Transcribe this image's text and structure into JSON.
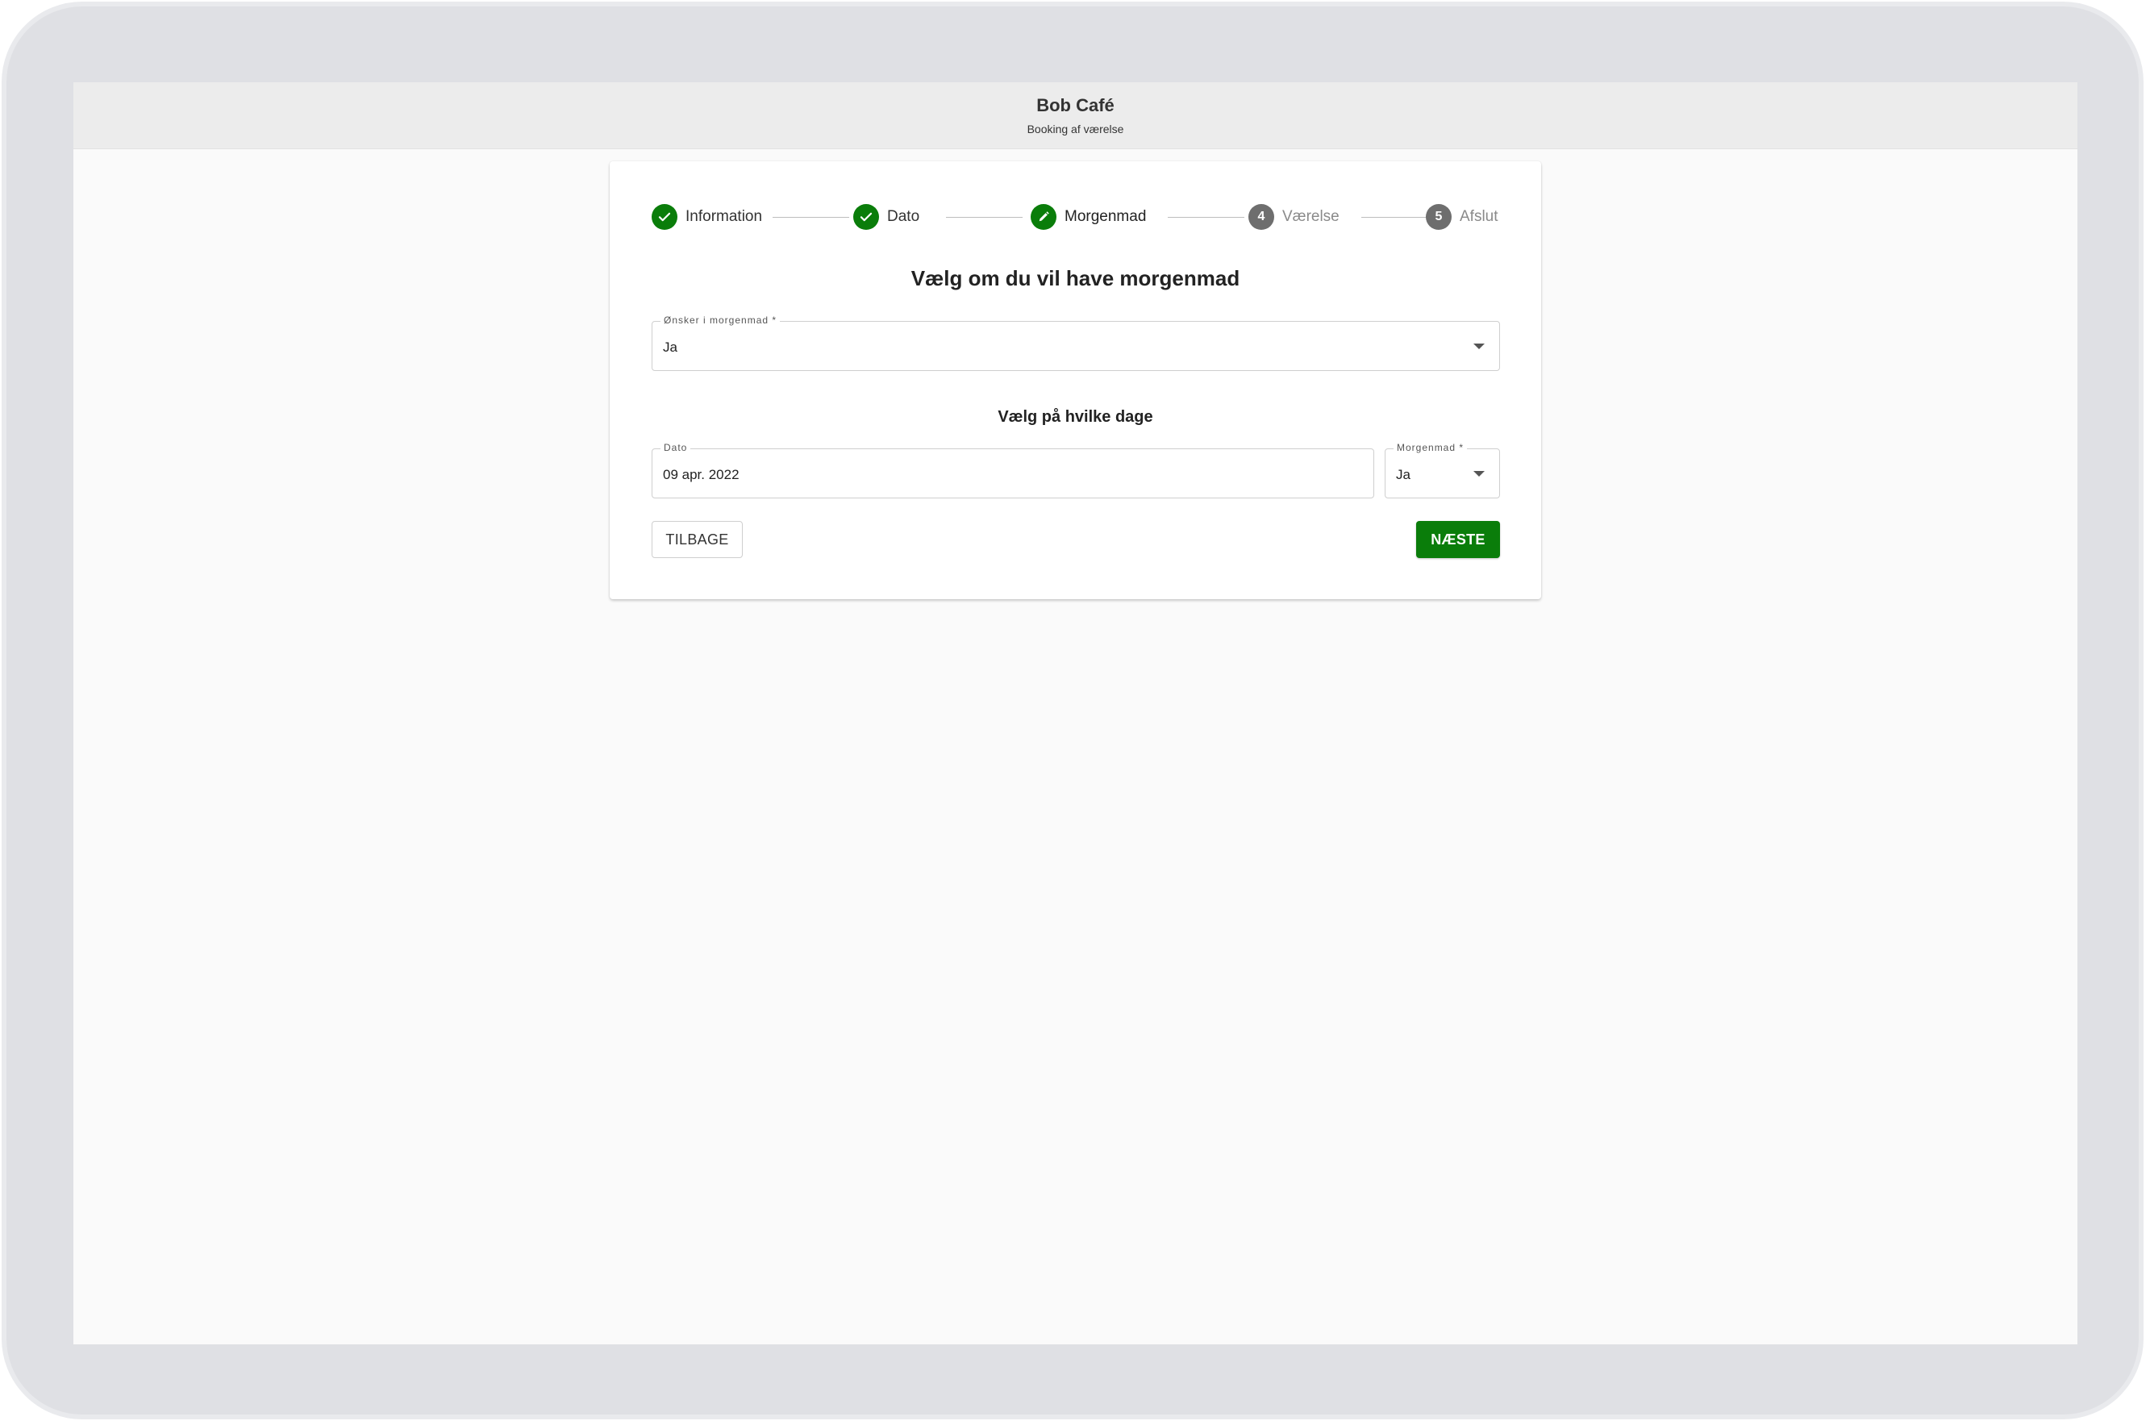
{
  "app": {
    "title": "Bob Café",
    "subtitle": "Booking af værelse"
  },
  "stepper": {
    "steps": [
      {
        "label": "Information",
        "state": "done",
        "icon": "check-icon"
      },
      {
        "label": "Dato",
        "state": "done",
        "icon": "check-icon"
      },
      {
        "label": "Morgenmad",
        "state": "active",
        "icon": "pencil-icon"
      },
      {
        "label": "Værelse",
        "state": "todo",
        "number": "4"
      },
      {
        "label": "Afslut",
        "state": "todo",
        "number": "5"
      }
    ]
  },
  "form": {
    "heading": "Vælg om du vil have morgenmad",
    "breakfast_select": {
      "label": "Ønsker i morgenmad *",
      "value": "Ja"
    },
    "days_heading": "Vælg på hvilke dage",
    "date_field": {
      "label": "Dato",
      "value": "09 apr. 2022"
    },
    "day_breakfast_select": {
      "label": "Morgenmad *",
      "value": "Ja"
    },
    "back_label": "TILBAGE",
    "next_label": "NÆSTE"
  },
  "colors": {
    "accent": "#0a7d0a",
    "inactive_step": "#6e6e6e",
    "background": "#fafafa"
  }
}
